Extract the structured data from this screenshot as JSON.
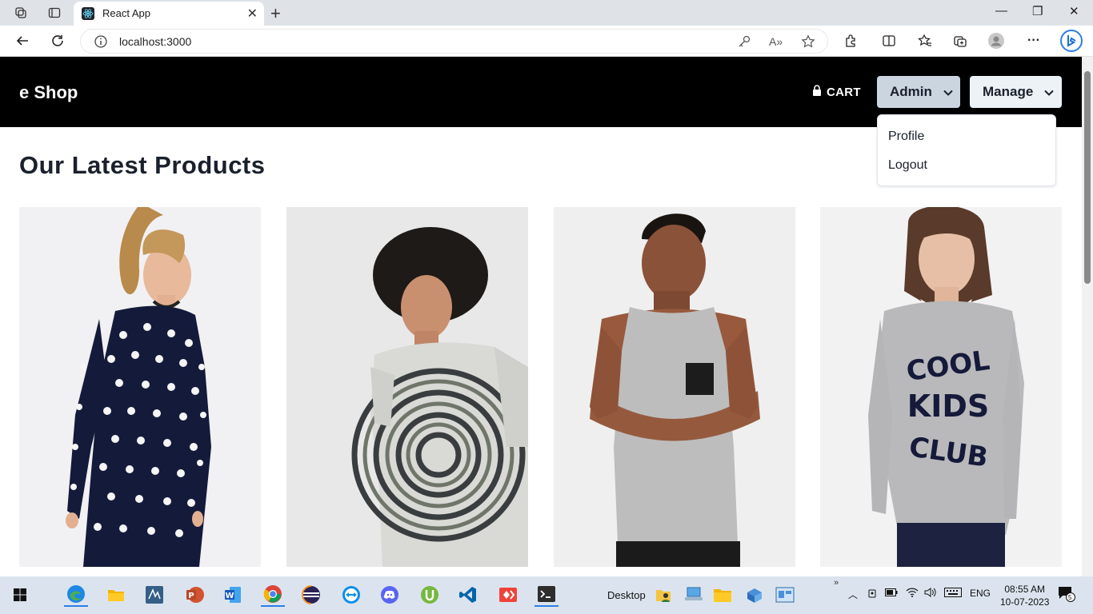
{
  "browser": {
    "tab_title": "React App",
    "url": "localhost:3000"
  },
  "navbar": {
    "brand": "e Shop",
    "cart_label": "CART",
    "admin_label": "Admin",
    "manage_label": "Manage"
  },
  "admin_menu": {
    "items": [
      "Profile",
      "Logout"
    ]
  },
  "main": {
    "heading": "Our Latest Products",
    "products": [
      {
        "image": "woman-polka-dot-dress"
      },
      {
        "image": "man-tie-dye-tshirt"
      },
      {
        "image": "man-grey-tank-top"
      },
      {
        "image": "woman-cool-kids-club-sweatshirt",
        "print_text": [
          "COOL",
          "KIDS",
          "CLUB"
        ]
      }
    ]
  },
  "taskbar": {
    "desktop_label": "Desktop",
    "language": "ENG",
    "time": "08:55 AM",
    "date": "10-07-2023",
    "notification_count": "5"
  }
}
